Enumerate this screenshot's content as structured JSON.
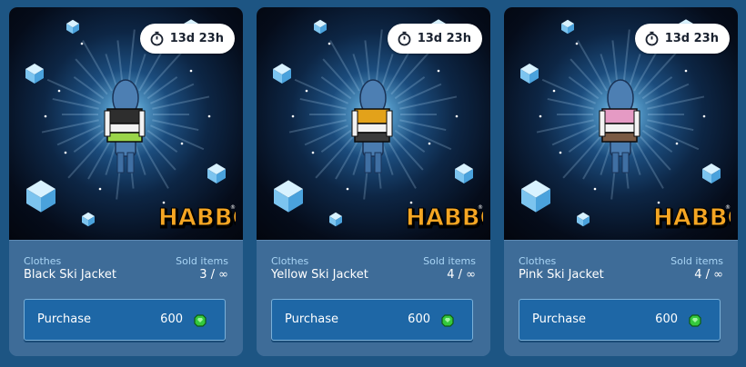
{
  "cards": [
    {
      "timer": "13d 23h",
      "category": "Clothes",
      "sold_label": "Sold items",
      "name": "Black Ski Jacket",
      "sold_count": "3 / ∞",
      "purchase_label": "Purchase",
      "price": "600",
      "jacket_color": "#2e2e2e",
      "jacket_accent": "#9ad44a"
    },
    {
      "timer": "13d 23h",
      "category": "Clothes",
      "sold_label": "Sold items",
      "name": "Yellow Ski Jacket",
      "sold_count": "4 / ∞",
      "purchase_label": "Purchase",
      "price": "600",
      "jacket_color": "#e3a21a",
      "jacket_accent": "#3a3a3a"
    },
    {
      "timer": "13d 23h",
      "category": "Clothes",
      "sold_label": "Sold items",
      "name": "Pink Ski Jacket",
      "sold_count": "4 / ∞",
      "purchase_label": "Purchase",
      "price": "600",
      "jacket_color": "#e59ac4",
      "jacket_accent": "#7a5a44"
    }
  ],
  "brand": "HABBO",
  "icons": {
    "timer": "stopwatch-icon",
    "currency": "emerald-gem-icon"
  },
  "colors": {
    "page_bg": "#1d5583",
    "card_bg": "#3e6c98",
    "button_bg": "#1e67a6",
    "label_color": "#a9d5f5",
    "gem": "#35c93c",
    "logo": "#f5a623"
  }
}
